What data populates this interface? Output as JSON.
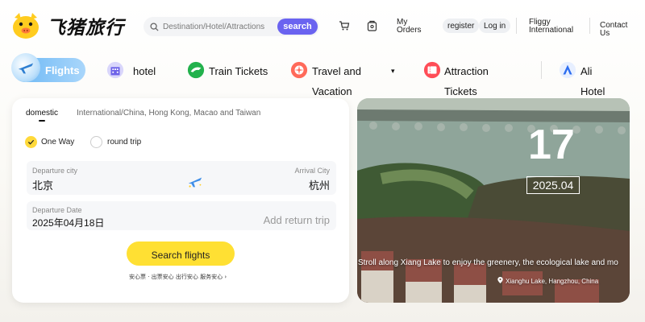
{
  "header": {
    "logo_text": "飞猪旅行",
    "search": {
      "placeholder": "Destination/Hotel/Attractions",
      "button_label": "search"
    },
    "cart_icon": "cart-icon",
    "orders_icon": "orders-icon",
    "my_orders_label": "My Orders",
    "register_label": "register",
    "login_label": "Log in",
    "international_label": "Fliggy International",
    "contact_label": "Contact Us"
  },
  "nav": {
    "items": [
      {
        "label": "Flights",
        "icon": "plane-icon",
        "active": true
      },
      {
        "label": "hotel",
        "icon": "hotel-icon"
      },
      {
        "label": "Train Tickets",
        "icon": "train-icon"
      },
      {
        "label": "Travel and Vacation",
        "icon": "vacation-icon"
      },
      {
        "label": "Attraction Tickets",
        "icon": "ticket-icon"
      },
      {
        "label": "Ali Hotel",
        "icon": "ali-hotel-icon"
      }
    ]
  },
  "booking": {
    "tabs": [
      "domestic",
      "International/China, Hong Kong, Macao and Taiwan"
    ],
    "trip_types": [
      {
        "label": "One Way",
        "selected": true
      },
      {
        "label": "round trip",
        "selected": false
      }
    ],
    "departure_city_label": "Departure city",
    "departure_city": "北京",
    "arrival_city_label": "Arrival City",
    "arrival_city": "杭州",
    "departure_date_label": "Departure Date",
    "departure_date": "2025年04月18日",
    "return_trip_label": "Add return trip",
    "search_button": "Search flights",
    "assurance_text": "安心票 · 出票安心 出行安心 服务安心 ›"
  },
  "banner": {
    "day": "17",
    "month": "2025.04",
    "caption": "Stroll along Xiang Lake to enjoy the greenery, the ecological lake and mo",
    "location": "Xianghu Lake, Hangzhou, China"
  },
  "colors": {
    "brand_yellow": "#ffd93a",
    "search_button": "#6a63f0",
    "flights_tab": "#69b6f4",
    "search_flights_button": "#ffe033"
  }
}
